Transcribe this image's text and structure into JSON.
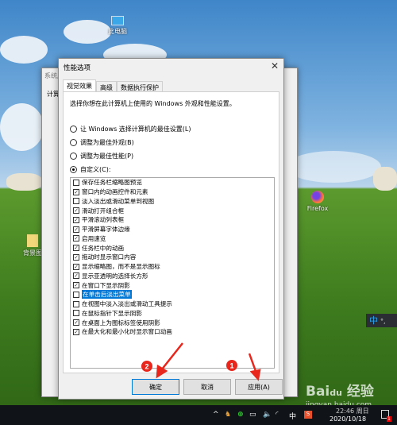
{
  "desktop": {
    "icons": [
      {
        "label": "此电脑",
        "icon": "computer-icon"
      },
      {
        "label": "背景图",
        "icon": "folder-icon"
      },
      {
        "label": "Firefox",
        "icon": "firefox-icon"
      }
    ]
  },
  "background_window": {
    "title": "系统属性",
    "tab": "计算"
  },
  "dialog": {
    "title": "性能选项",
    "close_icon": "close-icon",
    "tabs": [
      {
        "label": "视觉效果",
        "active": true
      },
      {
        "label": "高级"
      },
      {
        "label": "数据执行保护"
      }
    ],
    "description": "选择你想在此计算机上使用的 Windows 外观和性能设置。",
    "radios": [
      {
        "label": "让 Windows 选择计算机的最佳设置(L)",
        "checked": false
      },
      {
        "label": "调整为最佳外观(B)",
        "checked": false
      },
      {
        "label": "调整为最佳性能(P)",
        "checked": false
      },
      {
        "label": "自定义(C):",
        "checked": true
      }
    ],
    "options": [
      {
        "label": "保存任务栏缩略图预览",
        "checked": false
      },
      {
        "label": "窗口内的动画控件和元素",
        "checked": true
      },
      {
        "label": "淡入淡出或滑动菜单到视图",
        "checked": false
      },
      {
        "label": "滑动打开组合框",
        "checked": true
      },
      {
        "label": "平滑滚动列表框",
        "checked": true
      },
      {
        "label": "平滑屏幕字体边缘",
        "checked": true
      },
      {
        "label": "启用速览",
        "checked": true
      },
      {
        "label": "任务栏中的动画",
        "checked": true
      },
      {
        "label": "拖动时显示窗口内容",
        "checked": true
      },
      {
        "label": "显示缩略图，而不是显示图标",
        "checked": true
      },
      {
        "label": "显示亚透明的选择长方形",
        "checked": true
      },
      {
        "label": "在窗口下显示阴影",
        "checked": true
      },
      {
        "label": "在单击后淡出菜单",
        "checked": false,
        "selected": true
      },
      {
        "label": "在视图中淡入淡出或滑动工具提示",
        "checked": false
      },
      {
        "label": "在鼠标指针下显示阴影",
        "checked": false
      },
      {
        "label": "在桌面上为图标标签使用阴影",
        "checked": true
      },
      {
        "label": "在最大化和最小化时显示窗口动画",
        "checked": true
      }
    ],
    "buttons": {
      "ok": "确定",
      "cancel": "取消",
      "apply": "应用(A)"
    }
  },
  "annotations": [
    {
      "number": "1",
      "target": "应用(A)"
    },
    {
      "number": "2",
      "target": "确定"
    }
  ],
  "annotation_color": "#e8261c",
  "ime_float": {
    "label": "中",
    "punct": "°,"
  },
  "taskbar": {
    "ime": "中",
    "time": "22:46 周日",
    "date": "2020/10/18",
    "notification_count": "1"
  },
  "watermark": {
    "logo": "Bai du 经验",
    "url": "jingyan.baidu.com"
  }
}
